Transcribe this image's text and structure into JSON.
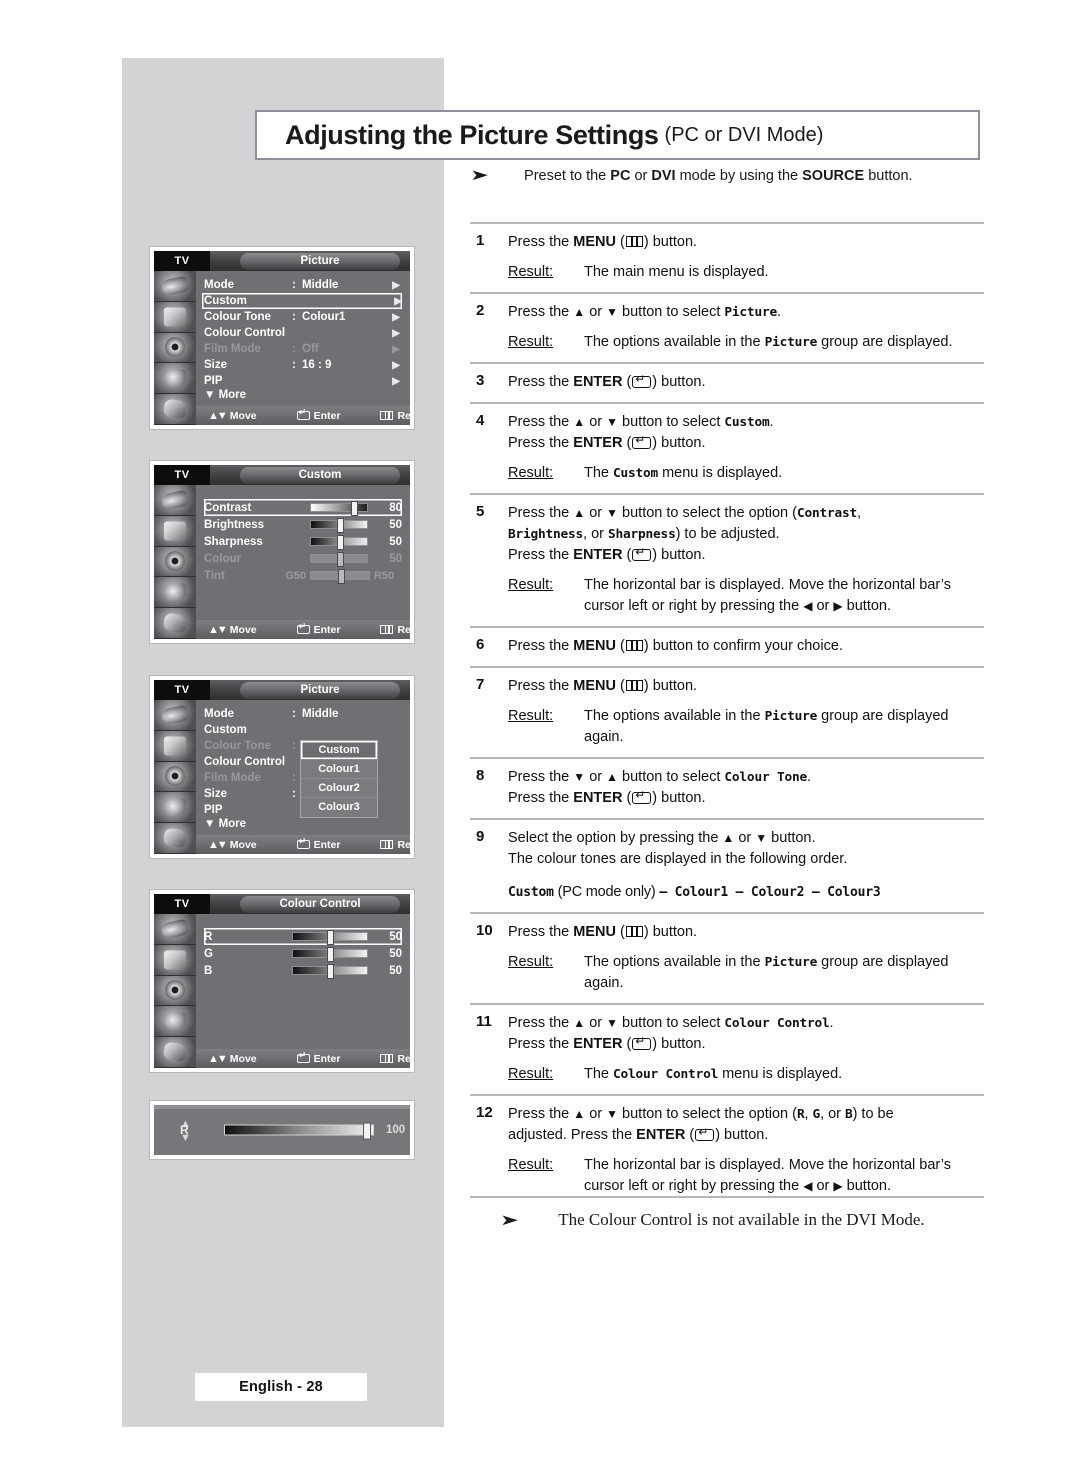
{
  "page": {
    "title_main": "Adjusting the Picture Settings",
    "title_sub": "(PC or DVI Mode)",
    "page_tag": "English - 28",
    "preset_note": "Preset to the PC or DVI mode by using the SOURCE button.",
    "footer_note": "The Colour Control is not available in the DVI Mode."
  },
  "steps": [
    {
      "num": "1",
      "lines": [
        "Press the MENU ( ▥ ) button."
      ],
      "result_label": "Result:",
      "result": "The main menu is displayed."
    },
    {
      "num": "2",
      "lines": [
        "Press the ▲ or ▼ button to select Picture."
      ],
      "result_label": "Result:",
      "result": "The options available in the Picture group are displayed."
    },
    {
      "num": "3",
      "lines": [
        "Press the ENTER ( ↵ ) button."
      ],
      "result_label": "",
      "result": ""
    },
    {
      "num": "4",
      "lines": [
        "Press the ▲ or ▼ button to select Custom.",
        "Press the ENTER ( ↵ ) button."
      ],
      "result_label": "Result:",
      "result": "The Custom menu is displayed."
    },
    {
      "num": "5",
      "lines": [
        "Press the ▲ or ▼ button to select the option (Contrast, Brightness, or Sharpness) to be adjusted.",
        "Press the ENTER ( ↵ ) button."
      ],
      "result_label": "Result:",
      "result": "The horizontal bar is displayed. Move the horizontal bar's cursor left or right by pressing the ◀ or ▶ button."
    },
    {
      "num": "6",
      "lines": [
        "Press the MENU ( ▥ ) button to confirm your choice."
      ],
      "result_label": "",
      "result": ""
    },
    {
      "num": "7",
      "lines": [
        "Press the MENU ( ▥ ) button."
      ],
      "result_label": "Result:",
      "result": "The options available in the Picture group are displayed again."
    },
    {
      "num": "8",
      "lines": [
        "Press the ▼ or ▲ button to select Colour Tone.",
        "Press the ENTER ( ↵ ) button."
      ],
      "result_label": "",
      "result": ""
    },
    {
      "num": "9",
      "lines": [
        "Select the option by pressing the ▲ or ▼ button.",
        "The colour tones are displayed in the following order."
      ],
      "order_line": "Custom (PC mode only) – Colour1 – Colour2 – Colour3",
      "result_label": "",
      "result": ""
    },
    {
      "num": "10",
      "lines": [
        "Press the MENU ( ▥ ) button."
      ],
      "result_label": "Result:",
      "result": "The options available in the Picture group are displayed again."
    },
    {
      "num": "11",
      "lines": [
        "Press the ▲ or ▼ button to select Colour Control.",
        "Press the ENTER ( ↵ ) button."
      ],
      "result_label": "Result:",
      "result": "The Colour Control menu is displayed."
    },
    {
      "num": "12",
      "lines": [
        "Press the ▲ or ▼ button to select the option (R, G, or B) to be adjusted. Press the ENTER ( ↵ ) button."
      ],
      "result_label": "Result:",
      "result": "The horizontal bar is displayed. Move the horizontal bar's cursor left or right by pressing the ◀ or ▶ button."
    }
  ],
  "osd_common": {
    "tv_label": "TV",
    "footer": {
      "move": "Move",
      "enter": "Enter",
      "return": "Return"
    },
    "icons": [
      "input-plug-icon",
      "tv-picture-icon",
      "speaker-sound-icon",
      "setup-fan-icon",
      "theatre-masks-icon"
    ]
  },
  "osd1": {
    "tab": "Picture",
    "rows": [
      {
        "label": "Mode",
        "colon": ":",
        "value": "Middle",
        "arrow": "▶",
        "state": "normal"
      },
      {
        "label": "Custom",
        "colon": "",
        "value": "",
        "arrow": "▶",
        "state": "selected"
      },
      {
        "label": "Colour Tone",
        "colon": ":",
        "value": "Colour1",
        "arrow": "▶",
        "state": "normal"
      },
      {
        "label": "Colour Control",
        "colon": "",
        "value": "",
        "arrow": "▶",
        "state": "normal"
      },
      {
        "label": "Film Mode",
        "colon": ":",
        "value": "Off",
        "arrow": "▶",
        "state": "dim"
      },
      {
        "label": "Size",
        "colon": ":",
        "value": "16 : 9",
        "arrow": "▶",
        "state": "normal"
      },
      {
        "label": "PIP",
        "colon": "",
        "value": "",
        "arrow": "▶",
        "state": "normal"
      }
    ],
    "more": "▼ More"
  },
  "osd2": {
    "tab": "Custom",
    "sliders": [
      {
        "name": "Contrast",
        "pre": "",
        "value": "80",
        "post": "",
        "pos": 72,
        "state": "selected",
        "grad": "g1"
      },
      {
        "name": "Brightness",
        "pre": "",
        "value": "50",
        "post": "",
        "pos": 48,
        "state": "normal",
        "grad": "g2"
      },
      {
        "name": "Sharpness",
        "pre": "",
        "value": "50",
        "post": "",
        "pos": 48,
        "state": "normal",
        "grad": "g3"
      },
      {
        "name": "Colour",
        "pre": "",
        "value": "50",
        "post": "",
        "pos": 48,
        "state": "dim",
        "grad": "flat"
      },
      {
        "name": "Tint",
        "pre": "G50",
        "value": "",
        "post": "R50",
        "pos": 48,
        "state": "dim",
        "grad": "flat"
      }
    ]
  },
  "osd3": {
    "tab": "Picture",
    "rows": [
      {
        "label": "Mode",
        "colon": ":",
        "value": "Middle",
        "state": "normal"
      },
      {
        "label": "Custom",
        "colon": "",
        "value": "",
        "state": "normal"
      },
      {
        "label": "Colour Tone",
        "colon": ":",
        "value": "",
        "state": "dim"
      },
      {
        "label": "Colour Control",
        "colon": "",
        "value": "",
        "state": "normal"
      },
      {
        "label": "Film Mode",
        "colon": ":",
        "value": "",
        "state": "dim"
      },
      {
        "label": "Size",
        "colon": ":",
        "value": "",
        "state": "normal"
      },
      {
        "label": "PIP",
        "colon": "",
        "value": "",
        "state": "normal"
      }
    ],
    "more": "▼ More",
    "dropdown": [
      "Custom",
      "Colour1",
      "Colour2",
      "Colour3"
    ]
  },
  "osd4": {
    "tab": "Colour Control",
    "sliders": [
      {
        "name": "R",
        "value": "50",
        "pos": 48,
        "state": "selected",
        "grad": "g2"
      },
      {
        "name": "G",
        "value": "50",
        "pos": 48,
        "state": "normal",
        "grad": "g2"
      },
      {
        "name": "B",
        "value": "50",
        "pos": 48,
        "state": "normal",
        "grad": "g2"
      }
    ]
  },
  "barwidget": {
    "label": "R",
    "value": "100",
    "up": "▲",
    "down": "▼"
  }
}
